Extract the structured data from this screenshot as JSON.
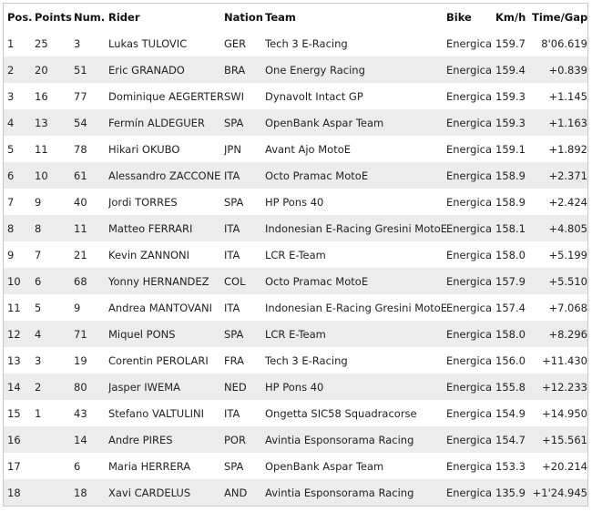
{
  "headers": [
    "Pos.",
    "Points",
    "Num.",
    "Rider",
    "Nation",
    "Team",
    "Bike",
    "Km/h",
    "Time/Gap"
  ],
  "rows": [
    [
      "1",
      "25",
      "3",
      "Lukas TULOVIC",
      "GER",
      "Tech 3 E-Racing",
      "Energica",
      "159.7",
      "8'06.619"
    ],
    [
      "2",
      "20",
      "51",
      "Eric GRANADO",
      "BRA",
      "One Energy Racing",
      "Energica",
      "159.4",
      "+0.839"
    ],
    [
      "3",
      "16",
      "77",
      "Dominique AEGERTER",
      "SWI",
      "Dynavolt Intact GP",
      "Energica",
      "159.3",
      "+1.145"
    ],
    [
      "4",
      "13",
      "54",
      "Fermín ALDEGUER",
      "SPA",
      "OpenBank Aspar Team",
      "Energica",
      "159.3",
      "+1.163"
    ],
    [
      "5",
      "11",
      "78",
      "Hikari OKUBO",
      "JPN",
      "Avant Ajo MotoE",
      "Energica",
      "159.1",
      "+1.892"
    ],
    [
      "6",
      "10",
      "61",
      "Alessandro ZACCONE",
      "ITA",
      "Octo Pramac MotoE",
      "Energica",
      "158.9",
      "+2.371"
    ],
    [
      "7",
      "9",
      "40",
      "Jordi TORRES",
      "SPA",
      "HP Pons 40",
      "Energica",
      "158.9",
      "+2.424"
    ],
    [
      "8",
      "8",
      "11",
      "Matteo FERRARI",
      "ITA",
      "Indonesian E-Racing Gresini MotoE",
      "Energica",
      "158.1",
      "+4.805"
    ],
    [
      "9",
      "7",
      "21",
      "Kevin ZANNONI",
      "ITA",
      "LCR E-Team",
      "Energica",
      "158.0",
      "+5.199"
    ],
    [
      "10",
      "6",
      "68",
      "Yonny HERNANDEZ",
      "COL",
      "Octo Pramac MotoE",
      "Energica",
      "157.9",
      "+5.510"
    ],
    [
      "11",
      "5",
      "9",
      "Andrea MANTOVANI",
      "ITA",
      "Indonesian E-Racing Gresini MotoE",
      "Energica",
      "157.4",
      "+7.068"
    ],
    [
      "12",
      "4",
      "71",
      "Miquel PONS",
      "SPA",
      "LCR E-Team",
      "Energica",
      "158.0",
      "+8.296"
    ],
    [
      "13",
      "3",
      "19",
      "Corentin PEROLARI",
      "FRA",
      "Tech 3 E-Racing",
      "Energica",
      "156.0",
      "+11.430"
    ],
    [
      "14",
      "2",
      "80",
      "Jasper IWEMA",
      "NED",
      "HP Pons 40",
      "Energica",
      "155.8",
      "+12.233"
    ],
    [
      "15",
      "1",
      "43",
      "Stefano VALTULINI",
      "ITA",
      "Ongetta SIC58 Squadracorse",
      "Energica",
      "154.9",
      "+14.950"
    ],
    [
      "16",
      "",
      "14",
      "Andre PIRES",
      "POR",
      "Avintia Esponsorama Racing",
      "Energica",
      "154.7",
      "+15.561"
    ],
    [
      "17",
      "",
      "6",
      "Maria HERRERA",
      "SPA",
      "OpenBank Aspar Team",
      "Energica",
      "153.3",
      "+20.214"
    ],
    [
      "18",
      "",
      "18",
      "Xavi CARDELUS",
      "AND",
      "Avintia Esponsorama Racing",
      "Energica",
      "135.9",
      "+1'24.945"
    ]
  ]
}
